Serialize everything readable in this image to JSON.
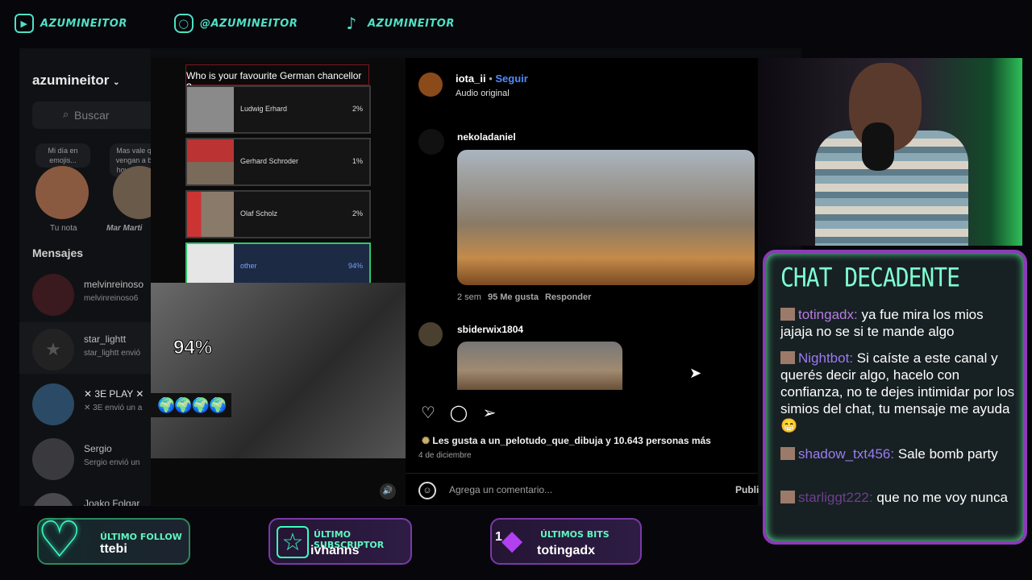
{
  "social": {
    "youtube": "AZUMINEITOR",
    "instagram": "@AZUMINEITOR",
    "tiktok": "AZUMINEITOR"
  },
  "ig_sidebar": {
    "username": "azumineitor",
    "search_placeholder": "Buscar",
    "notes": [
      {
        "text": "Mi día en emojis..."
      },
      {
        "text": "Mas vale q vengan a b hoy...salgo"
      }
    ],
    "story_labels": [
      "Tu nota",
      "Mar Marti"
    ],
    "messages_header": "Mensajes",
    "threads": [
      {
        "name": "melvinreinoso",
        "snippet": "melvinreinoso6"
      },
      {
        "name": "star_lightt",
        "snippet": "star_lightt envió"
      },
      {
        "name": "✕ 3E PLAY ✕",
        "snippet": "✕ 3E envió un a"
      },
      {
        "name": "Sergio",
        "snippet": "Sergio envió un"
      },
      {
        "name": "Joako Folgar",
        "snippet": ""
      }
    ]
  },
  "reel": {
    "poll_question": "Who is your favourite German chancellor ?",
    "options": [
      {
        "name": "Ludwig Erhard",
        "pct": "2%"
      },
      {
        "name": "Gerhard Schroder",
        "pct": "1%"
      },
      {
        "name": "Olaf Scholz",
        "pct": "2%"
      },
      {
        "name": "other",
        "pct": "94%"
      }
    ],
    "big_pct": "94%",
    "globes": "🌍🌍🌍🌍"
  },
  "post": {
    "author": "iota_ii",
    "follow": "Seguir",
    "audio": "Audio original",
    "comments": [
      {
        "user": "nekoladaniel",
        "time": "2 sem",
        "likes": "95 Me gusta",
        "reply": "Responder"
      },
      {
        "user": "sbiderwix1804"
      }
    ],
    "likes_text": "Les gusta a un_pelotudo_que_dibuja y 10.643 personas más",
    "date": "4 de diciembre",
    "add_comment_placeholder": "Agrega un comentario...",
    "publish": "Publi"
  },
  "chat": {
    "title": "CHAT DECADENTE",
    "messages": [
      {
        "user": "totingadx:",
        "text": " ya fue mira los mios jajaja no se si te mande algo"
      },
      {
        "user": "Nightbot:",
        "text": " Si caíste a este canal y querés decir algo, hacelo con confianza, no te dejes intimidar por los simios del chat, tu mensaje me ayuda 😁"
      },
      {
        "user": "shadow_txt456:",
        "text": " Sale bomb party"
      },
      {
        "user": "starliggt222:",
        "text": " que no me voy nunca"
      }
    ]
  },
  "alerts": {
    "follow_label": "ÚLTIMO FOLLOW",
    "follow_value": "ttebi",
    "sub_label": "ÚLTIMO SUBSCRIPTOR",
    "sub_value": "ivhanns",
    "bits_label": "ÚLTIMOS BITS",
    "bits_value": "totingadx",
    "bits_count": "1"
  }
}
